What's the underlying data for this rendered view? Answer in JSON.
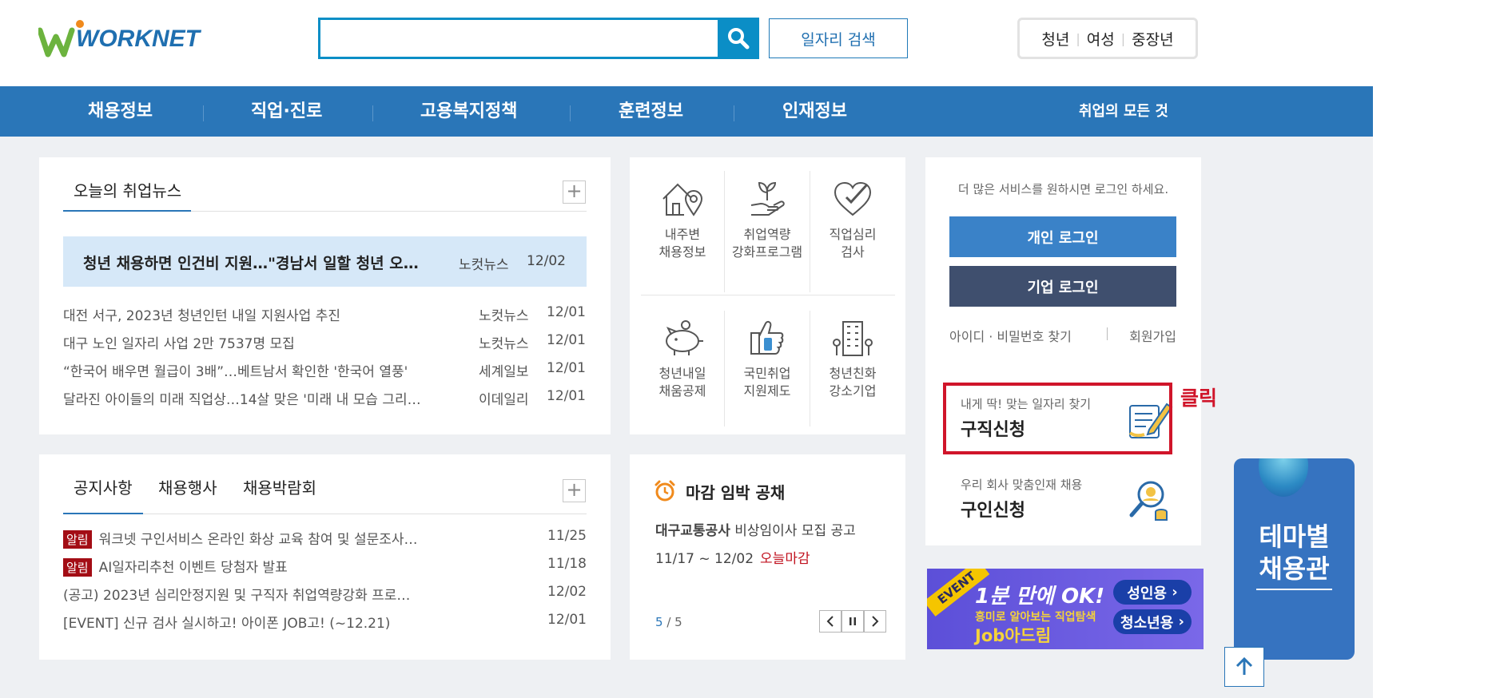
{
  "header": {
    "logo_text": "WORKNET",
    "search": {
      "placeholder": "",
      "value": ""
    },
    "job_search_button": "일자리 검색",
    "target_tabs": [
      "청년",
      "여성",
      "중장년"
    ]
  },
  "nav": {
    "items": [
      "채용정보",
      "직업·진로",
      "고용복지정책",
      "훈련정보",
      "인재정보"
    ],
    "right": "취업의 모든 것"
  },
  "news": {
    "title": "오늘의 취업뉴스",
    "plus": "+",
    "featured": {
      "title": "청년 채용하면 인건비 지원…\"경남서 일할 청년 오…",
      "source": "노컷뉴스",
      "date": "12/02"
    },
    "items": [
      {
        "title": "대전 서구, 2023년 청년인턴 내일 지원사업 추진",
        "source": "노컷뉴스",
        "date": "12/01"
      },
      {
        "title": "대구 노인 일자리 사업 2만 7537명 모집",
        "source": "노컷뉴스",
        "date": "12/01"
      },
      {
        "title": "“한국어 배우면 월급이 3배”…베트남서 확인한 '한국어 열풍'",
        "source": "세계일보",
        "date": "12/01"
      },
      {
        "title": "달라진 아이들의 미래 직업상…14살 맞은 '미래 내 모습 그리…",
        "source": "이데일리",
        "date": "12/01"
      }
    ]
  },
  "services": [
    {
      "icon": "house-location-icon",
      "line1": "내주변",
      "line2": "채용정보"
    },
    {
      "icon": "hand-sprout-icon",
      "line1": "취업역량",
      "line2": "강화프로그램"
    },
    {
      "icon": "heart-check-icon",
      "line1": "직업심리",
      "line2": "검사"
    },
    {
      "icon": "piggy-bank-icon",
      "line1": "청년내일",
      "line2": "채움공제"
    },
    {
      "icon": "thumbs-up-icon",
      "line1": "국민취업",
      "line2": "지원제도"
    },
    {
      "icon": "building-icon",
      "line1": "청년친화",
      "line2": "강소기업"
    }
  ],
  "login": {
    "message": "더 많은 서비스를 원하시면 로그인 하세요.",
    "personal_button": "개인 로그인",
    "company_button": "기업 로그인",
    "find_link": "아이디 · 비밀번호 찾기",
    "join_link": "회원가입",
    "job_apply": {
      "sub": "내게 딱! 맞는 일자리 찾기",
      "main": "구직신청",
      "icon": "document-pen-icon"
    },
    "hire_apply": {
      "sub": "우리 회사 맞춤인재 채용",
      "main": "구인신청",
      "icon": "person-search-icon"
    }
  },
  "annotation": {
    "click_label": "클릭",
    "color": "#d0152a"
  },
  "notice": {
    "tabs": [
      "공지사항",
      "채용행사",
      "채용박람회"
    ],
    "plus": "+",
    "items": [
      {
        "badge": "알림",
        "title": "워크넷 구인서비스 온라인 화상 교육 참여 및 설문조사…",
        "date": "11/25"
      },
      {
        "badge": "알림",
        "title": "AI일자리추천 이벤트 당첨자 발표",
        "date": "11/18"
      },
      {
        "badge": "",
        "title": "(공고) 2023년 심리안정지원 및 구직자 취업역량강화 프로…",
        "date": "12/02"
      },
      {
        "badge": "",
        "title": "[EVENT] 신규 검사 실시하고! 아이폰 JOB고! (~12.21)",
        "date": "12/01"
      }
    ]
  },
  "deadline": {
    "title": "마감 임박 공채",
    "company": "대구교통공사",
    "posting": "비상임이사 모집 공고",
    "period": "11/17 ~ 12/02",
    "status": "오늘마감",
    "page_current": "5",
    "page_total": "/ 5"
  },
  "banner": {
    "event": "EVENT",
    "headline": "1분 만에 OK!",
    "sub": "흥미로 알아보는 직업탐색",
    "brand": "Job아드림",
    "adult_button": "성인용",
    "youth_button": "청소년용"
  },
  "theme_banner": {
    "line1": "테마별",
    "line2": "채용관"
  },
  "colors": {
    "nav": "#2a76b8",
    "accent": "#0b8ec6",
    "highlight": "#d6e8f8",
    "deadline_red": "#c1121f"
  }
}
